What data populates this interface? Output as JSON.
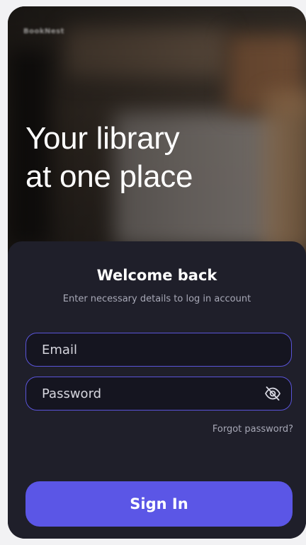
{
  "app": {
    "logo_text": "BookNest",
    "headline_line1": "Your library",
    "headline_line2": "at one place"
  },
  "login": {
    "title": "Welcome back",
    "subtitle": "Enter necessary details to log in account",
    "email": {
      "value": "",
      "placeholder": "Email"
    },
    "password": {
      "value": "",
      "placeholder": "Password",
      "visibility_icon": "eye-off-icon"
    },
    "forgot_label": "Forgot password?",
    "submit_label": "Sign In"
  },
  "colors": {
    "accent": "#5b56e6",
    "field_border": "#5a54d9",
    "sheet_bg": "#1f1f2a",
    "field_bg": "#151520",
    "muted_text": "#a7a8b6"
  }
}
